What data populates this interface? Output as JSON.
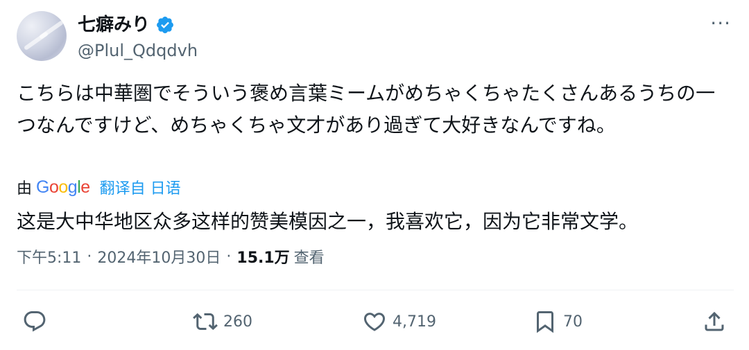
{
  "author": {
    "display_name": "七癖みり",
    "handle": "@Plul_Qdqdvh",
    "verified_icon": "verified-badge-icon",
    "verified_color": "#1d9bf0"
  },
  "tweet": {
    "text": "こちらは中華圏でそういう褒め言葉ミームがめちゃくちゃたくさんあるうちの一つなんですけど、めちゃくちゃ文才があり過ぎて大好きなんですね。"
  },
  "translation": {
    "by_label": "由",
    "google_logo": "Google",
    "from_label": "翻译自 日语",
    "text": "这是大中华地区众多这样的赞美模因之一，我喜欢它，因为它非常文学。"
  },
  "meta": {
    "time": "下午5:11",
    "date": "2024年10月30日",
    "views": "15.1万",
    "views_label": "查看"
  },
  "actions": {
    "reply_icon": "reply-icon",
    "retweet_count": "260",
    "like_count": "4,719",
    "bookmark_count": "70",
    "share_icon": "share-icon"
  },
  "colors": {
    "accent": "#1d9bf0",
    "secondary_text": "#536471",
    "primary_text": "#0f1419"
  }
}
